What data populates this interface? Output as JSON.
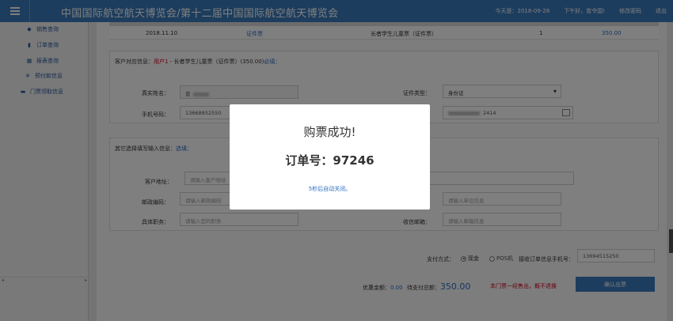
{
  "header": {
    "title": "中国国际航空航天博览会/第十二届中国国际航空航天博览会",
    "date": "今天是：2018-09-28",
    "greeting": "下午好，曾令国!",
    "change_password": "修改密码",
    "logout": "退出"
  },
  "sidebar": {
    "items": [
      {
        "label": "销售查询",
        "icon": "tag-icon"
      },
      {
        "label": "订单查询",
        "icon": "document-icon"
      },
      {
        "label": "报表查询",
        "icon": "grid-icon"
      },
      {
        "label": "预付款信息",
        "icon": "yen-icon"
      },
      {
        "label": "门票领取信息",
        "icon": "card-icon"
      }
    ]
  },
  "order_row": {
    "date": "2018.11.10",
    "type": "证件票",
    "ticket": "长者学生儿童票（证件票）",
    "qty": "1",
    "price": "350.00"
  },
  "customer_section": {
    "prefix": "客户对应信息：",
    "user": "用户1",
    "dash": " - ",
    "ticket_desc": "长者学生儿童票（证件票）(350.00)",
    "required": "必填：",
    "name_label": "真实姓名：",
    "name_value": "曾",
    "id_type_label": "证件类型：",
    "id_type_value": "身份证",
    "phone_label": "手机号码：",
    "phone_value": "13668852550",
    "id_value_tail": "2414"
  },
  "extra_section": {
    "title": "其它选择填写输入信息：",
    "optional": "选填：",
    "address_label": "客户地址：",
    "address_placeholder": "请输入客户地址",
    "zip_label": "邮政编码：",
    "zip_placeholder": "请输入邮政编码",
    "company_placeholder": "请输入单位信息",
    "position_label": "具体职务：",
    "position_placeholder": "请输入您的职务",
    "email_label": "收信邮箱：",
    "email_placeholder": "请输入邮箱信息"
  },
  "payment": {
    "method_label": "支付方式：",
    "cash": "现金",
    "pos": "POS机",
    "phone_label": "接收订单信息手机号：",
    "phone_value": "13694515250",
    "discount_label": "优惠金额：",
    "discount_value": "0.00",
    "total_label": "待支付总额：",
    "total_value": "350.00",
    "warning": "本门票一经售出，概不退换",
    "confirm_button": "确认出票"
  },
  "modal": {
    "title": "购票成功!",
    "order_label": "订单号：97246",
    "auto_close": "5秒后自动关闭。"
  },
  "colors": {
    "header_bg": "#3a7bbd",
    "link_blue": "#2a6cc0",
    "warning_red": "#d0021b"
  }
}
